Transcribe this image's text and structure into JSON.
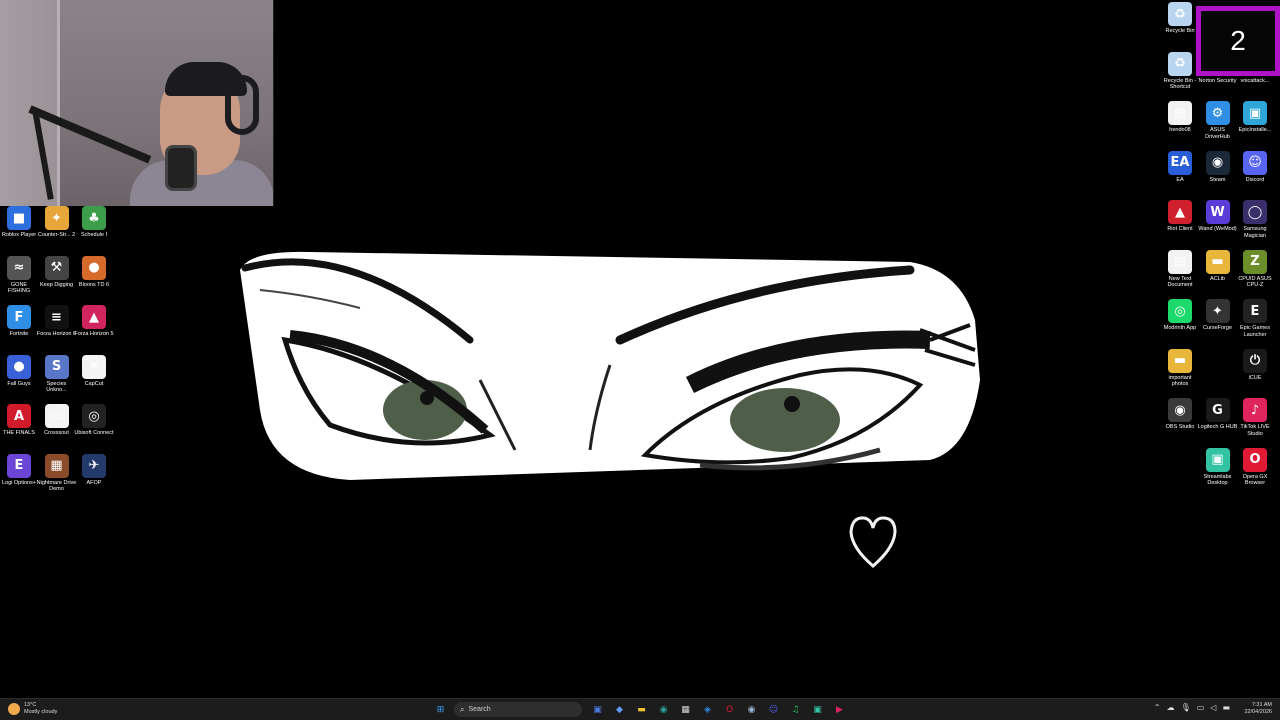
{
  "counter": {
    "value": "2"
  },
  "left_icons": [
    {
      "label": "Roblox Player",
      "glyph": "■",
      "color": "#2e6fe0"
    },
    {
      "label": "Counter-Str... 2",
      "glyph": "✦",
      "color": "#e8a63a"
    },
    {
      "label": "Schedule I",
      "glyph": "♣",
      "color": "#3c9e4a"
    },
    {
      "label": "GONE FISHING",
      "glyph": "≈",
      "color": "#555"
    },
    {
      "label": "Keep Digging",
      "glyph": "⚒",
      "color": "#444"
    },
    {
      "label": "Bloons TD 6",
      "glyph": "●",
      "color": "#d66a2a"
    },
    {
      "label": "Fortnite",
      "glyph": "F",
      "color": "#2f8fe6"
    },
    {
      "label": "Forza Horizon 6",
      "glyph": "≡",
      "color": "#111"
    },
    {
      "label": "Forza Horizon 5",
      "glyph": "▲",
      "color": "#d0255d"
    },
    {
      "label": "Fall Guys",
      "glyph": "●",
      "color": "#3a60d8"
    },
    {
      "label": "Species Unkno...",
      "glyph": "S",
      "color": "#5a76c8"
    },
    {
      "label": "CapCut",
      "glyph": "✕",
      "color": "#f4f4f4"
    },
    {
      "label": "THE FINALS",
      "glyph": "A",
      "color": "#d11a2a"
    },
    {
      "label": "Crosssout",
      "glyph": "▭",
      "color": "#f4f4f4"
    },
    {
      "label": "Ubisoft Connect",
      "glyph": "◎",
      "color": "#222"
    },
    {
      "label": "Logi Options+",
      "glyph": "E",
      "color": "#6b45d6"
    },
    {
      "label": "Nightmare Drive Demo",
      "glyph": "▦",
      "color": "#8a4b2a"
    },
    {
      "label": "AFOP",
      "glyph": "✈",
      "color": "#233a6b"
    }
  ],
  "right_icons": [
    {
      "label": "Recycle Bin",
      "glyph": "♻",
      "color": "#b8d4ef"
    },
    {
      "label": "Recycle Bin - Shortcut",
      "glyph": "♻",
      "color": "#b8d4ef"
    },
    {
      "label": "Norton Security",
      "glyph": "✓",
      "color": "#f2c22f"
    },
    {
      "label": "voicattack...",
      "glyph": "◆",
      "color": "#444"
    },
    {
      "label": "hendo08",
      "glyph": "▤",
      "color": "#f2f2f2"
    },
    {
      "label": "ASUS DriverHub",
      "glyph": "⚙",
      "color": "#2f8fe6"
    },
    {
      "label": "EpicInstalle...",
      "glyph": "▣",
      "color": "#2fa6d8"
    },
    {
      "label": "EA",
      "glyph": "EA",
      "color": "#2a5ed8"
    },
    {
      "label": "Steam",
      "glyph": "◉",
      "color": "#1b2838"
    },
    {
      "label": "Discord",
      "glyph": "☺",
      "color": "#5865f2"
    },
    {
      "label": "Riot Client",
      "glyph": "▲",
      "color": "#d0202e"
    },
    {
      "label": "Wand (WeMod)",
      "glyph": "W",
      "color": "#5a3dd8"
    },
    {
      "label": "Samsung Magician",
      "glyph": "◯",
      "color": "#3a2f6b"
    },
    {
      "label": "New Text Document",
      "glyph": "▤",
      "color": "#f2f2f2"
    },
    {
      "label": "ACLib",
      "glyph": "▬",
      "color": "#e8b63a"
    },
    {
      "label": "CPUID ASUS CPU-Z",
      "glyph": "Z",
      "color": "#6b8e2a"
    },
    {
      "label": "Modrinth App",
      "glyph": "◎",
      "color": "#1bd96a"
    },
    {
      "label": "CurseForge",
      "glyph": "✦",
      "color": "#333"
    },
    {
      "label": "Epic Games Launcher",
      "glyph": "E",
      "color": "#222"
    },
    {
      "label": "important photos",
      "glyph": "▬",
      "color": "#e8b63a"
    },
    {
      "label": "iCUE",
      "glyph": "⏻",
      "color": "#1a1a1a"
    },
    {
      "label": "OBS Studio",
      "glyph": "◉",
      "color": "#3a3a3a"
    },
    {
      "label": "Logitech G HUB",
      "glyph": "G",
      "color": "#1a1a1a"
    },
    {
      "label": "TikTok LIVE Studio",
      "glyph": "♪",
      "color": "#e0245e"
    },
    {
      "label": "Streamlabs Desktop",
      "glyph": "▣",
      "color": "#31c3a2"
    },
    {
      "label": "Opera GX Browser",
      "glyph": "O",
      "color": "#e01a35"
    }
  ],
  "taskbar": {
    "weather_temp": "13°C",
    "weather_text": "Mostly cloudy",
    "search_placeholder": "Search",
    "time": "7:31 AM",
    "date": "22/04/2026",
    "apps": [
      {
        "name": "start-icon",
        "glyph": "⊞",
        "color": "#3aa0ff"
      },
      {
        "name": "widgets-icon",
        "glyph": "≋",
        "color": "#7fb06a"
      },
      {
        "name": "task-view-icon",
        "glyph": "▢",
        "color": "#cfcfcf"
      },
      {
        "name": "store-icon",
        "glyph": "▣",
        "color": "#4a7de0"
      },
      {
        "name": "copilot-icon",
        "glyph": "◆",
        "color": "#5fa0ff"
      },
      {
        "name": "file-explorer-icon",
        "glyph": "▬",
        "color": "#f2c22f"
      },
      {
        "name": "edge-icon",
        "glyph": "◉",
        "color": "#2aa3a0"
      },
      {
        "name": "calendar-icon",
        "glyph": "▦",
        "color": "#d8d8d8"
      },
      {
        "name": "vpn-icon",
        "glyph": "◈",
        "color": "#2f8fe6"
      },
      {
        "name": "opera-icon",
        "glyph": "O",
        "color": "#e01a35"
      },
      {
        "name": "steam-icon",
        "glyph": "◉",
        "color": "#9ab8d8"
      },
      {
        "name": "discord-icon",
        "glyph": "☺",
        "color": "#5865f2"
      },
      {
        "name": "spotify-icon",
        "glyph": "♫",
        "color": "#1db954"
      },
      {
        "name": "streamlabs-icon",
        "glyph": "▣",
        "color": "#31c3a2"
      },
      {
        "name": "media-icon",
        "glyph": "▶",
        "color": "#e0245e"
      }
    ]
  }
}
